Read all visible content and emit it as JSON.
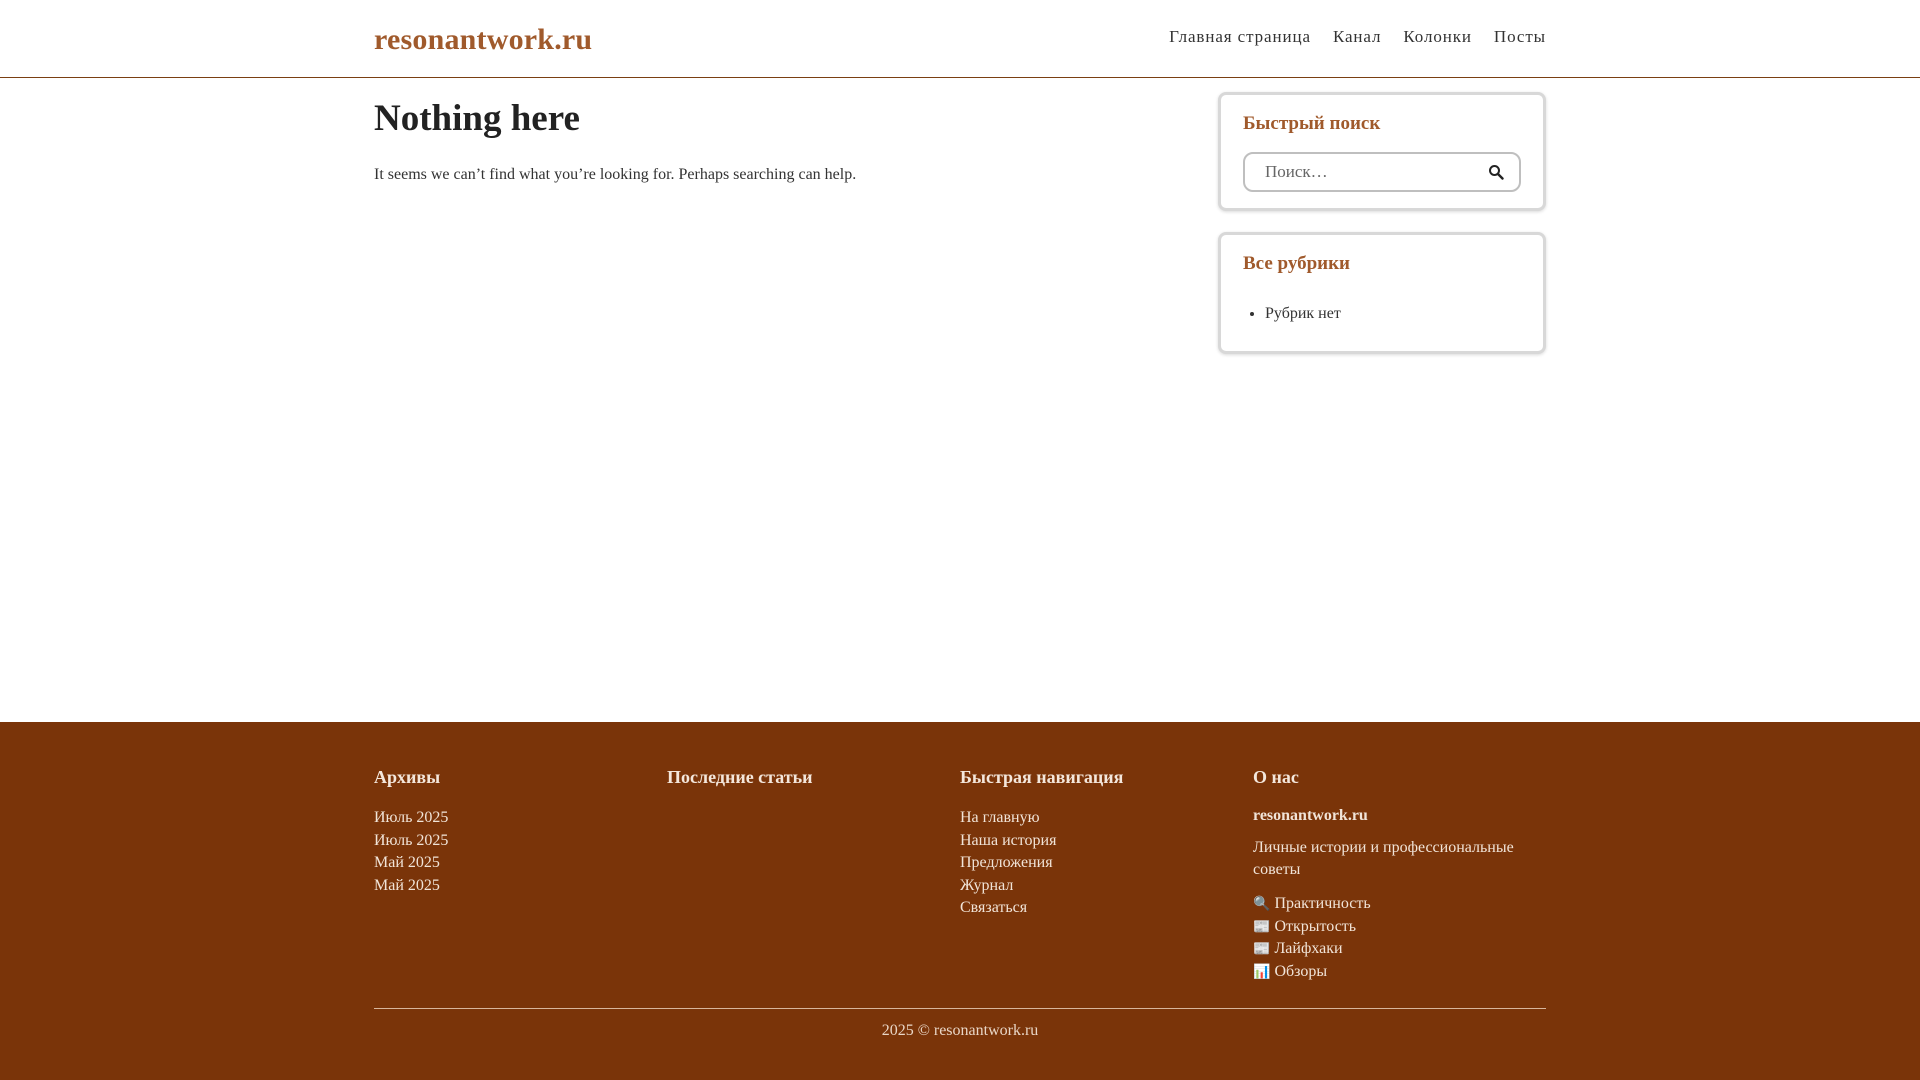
{
  "header": {
    "site_title": "resonantwork.ru",
    "nav": [
      "Главная страница",
      "Канал",
      "Колонки",
      "Посты"
    ]
  },
  "main": {
    "title": "Nothing here",
    "message": "It seems we can’t find what you’re looking for. Perhaps searching can help."
  },
  "sidebar": {
    "search_widget": {
      "title": "Быстрый поиск",
      "placeholder": "Поиск…",
      "icon": "search-icon"
    },
    "categories_widget": {
      "title": "Все рубрики",
      "items": [
        "Рубрик нет"
      ]
    }
  },
  "footer": {
    "archives": {
      "title": "Архивы",
      "items": [
        "Июль 2025",
        "Июль 2025",
        "Май 2025",
        "Май 2025"
      ]
    },
    "recent": {
      "title": "Последние статьи"
    },
    "quicknav": {
      "title": "Быстрая навигация",
      "items": [
        "На главную",
        "Наша история",
        "Предложения",
        "Журнал",
        "Связаться"
      ]
    },
    "about": {
      "title": "О нас",
      "name": "resonantwork.ru",
      "text": "Личные истории и профессиональные советы",
      "items": [
        {
          "emoji": "🔍",
          "label": "Практичность"
        },
        {
          "emoji": "📰",
          "label": "Открытость"
        },
        {
          "emoji": "📰",
          "label": "Лайфхаки"
        },
        {
          "emoji": "📊",
          "label": "Обзоры"
        }
      ]
    },
    "copyright": "2025 © resonantwork.ru"
  },
  "colors": {
    "accent": "#a05a2c",
    "footer_bg": "#7a3409",
    "text": "#222222"
  }
}
